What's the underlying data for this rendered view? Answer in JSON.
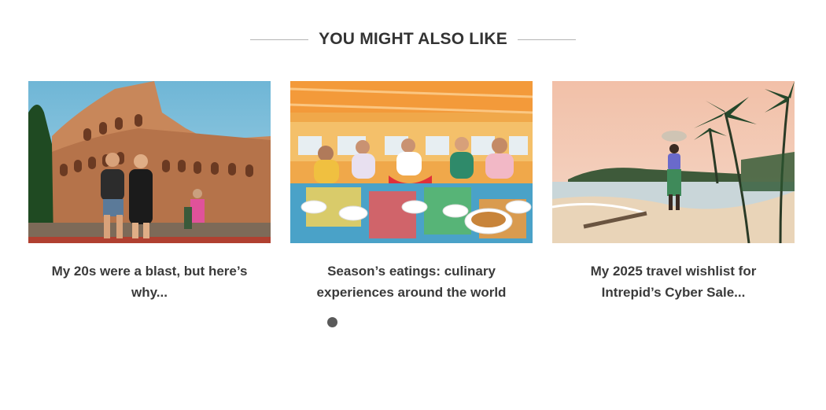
{
  "section": {
    "heading": "YOU MIGHT ALSO LIKE"
  },
  "cards": [
    {
      "title": "My 20s were a blast, but here’s why...",
      "image": "colosseum-photo"
    },
    {
      "title": "Season’s eatings: culinary experiences around the world",
      "image": "boat-feast-photo"
    },
    {
      "title": "My 2025 travel wishlist for Intrepid’s Cyber Sale...",
      "image": "beach-palms-photo"
    }
  ],
  "pager": {
    "dots": 1,
    "active_index": 0
  },
  "colors": {
    "heading_text": "#333333",
    "divider": "#b5b5b5",
    "pager_dot": "#5a5a5a"
  }
}
